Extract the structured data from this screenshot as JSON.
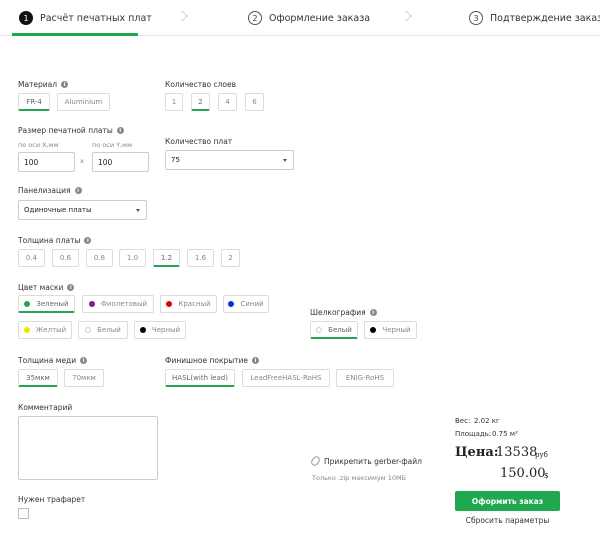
{
  "stepper": {
    "steps": [
      {
        "num": "1",
        "label": "Расчёт печатных плат"
      },
      {
        "num": "2",
        "label": "Оформление заказа"
      },
      {
        "num": "3",
        "label": "Подтверждение заказа"
      }
    ]
  },
  "material": {
    "label": "Материал",
    "options": [
      "FR-4",
      "Aluminium"
    ],
    "selected": "FR-4"
  },
  "layers": {
    "label": "Количество слоев",
    "options": [
      "1",
      "2",
      "4",
      "6"
    ],
    "selected": "2"
  },
  "size": {
    "label": "Размер печатной платы",
    "x_label": "по оси X,мм",
    "y_label": "по оси Y,мм",
    "x_value": "100",
    "y_value": "100",
    "separator": "x"
  },
  "quantity": {
    "label": "Количество плат",
    "value": "75"
  },
  "panelization": {
    "label": "Панелизация",
    "value": "Одиночные платы"
  },
  "thickness": {
    "label": "Толщина платы",
    "options": [
      "0.4",
      "0.6",
      "0.8",
      "1.0",
      "1.2",
      "1.6",
      "2"
    ],
    "selected": "1.2"
  },
  "mask": {
    "label": "Цвет маски",
    "options": [
      {
        "label": "Зеленый",
        "color": "#1fa84f"
      },
      {
        "label": "Фиолетовый",
        "color": "#8b1a8b"
      },
      {
        "label": "Красный",
        "color": "#e00000"
      },
      {
        "label": "Синий",
        "color": "#1030d0"
      },
      {
        "label": "Желтый",
        "color": "#f2e600"
      },
      {
        "label": "Белый",
        "color": "#ffffff"
      },
      {
        "label": "Черный",
        "color": "#000000"
      }
    ],
    "selected": "Зеленый"
  },
  "silkscreen": {
    "label": "Шелкография",
    "options": [
      {
        "label": "Белый",
        "color": "#ffffff"
      },
      {
        "label": "Черный",
        "color": "#000000"
      }
    ],
    "selected": "Белый"
  },
  "copper": {
    "label": "Толщина меди",
    "options": [
      "35мкм",
      "70мкм"
    ],
    "selected": "35мкм"
  },
  "finish": {
    "label": "Финишное покрытие",
    "options": [
      "HASL(with lead)",
      "LeadFreeHASL-RoHS",
      "ENIG-RoHS"
    ],
    "selected": "HASL(with lead)"
  },
  "comment": {
    "label": "Комментарий"
  },
  "stencil": {
    "label": "Нужен трафарет"
  },
  "attach": {
    "label": "Прикрепить gerber-файл",
    "hint": "Только .zip максимум 10МБ"
  },
  "summary": {
    "weight_label": "Вес:",
    "weight_value": "2.02 кг",
    "area_label": "Площадь:",
    "area_value": "0.75 м²",
    "price_label": "Цена:",
    "price_rub": "13538",
    "rub_unit": "руб",
    "price_usd": "150.00",
    "usd_unit": "$"
  },
  "actions": {
    "order": "Оформить заказ",
    "reset": "Сбросить параметры"
  },
  "colors": {
    "accent": "#1fa84f"
  }
}
